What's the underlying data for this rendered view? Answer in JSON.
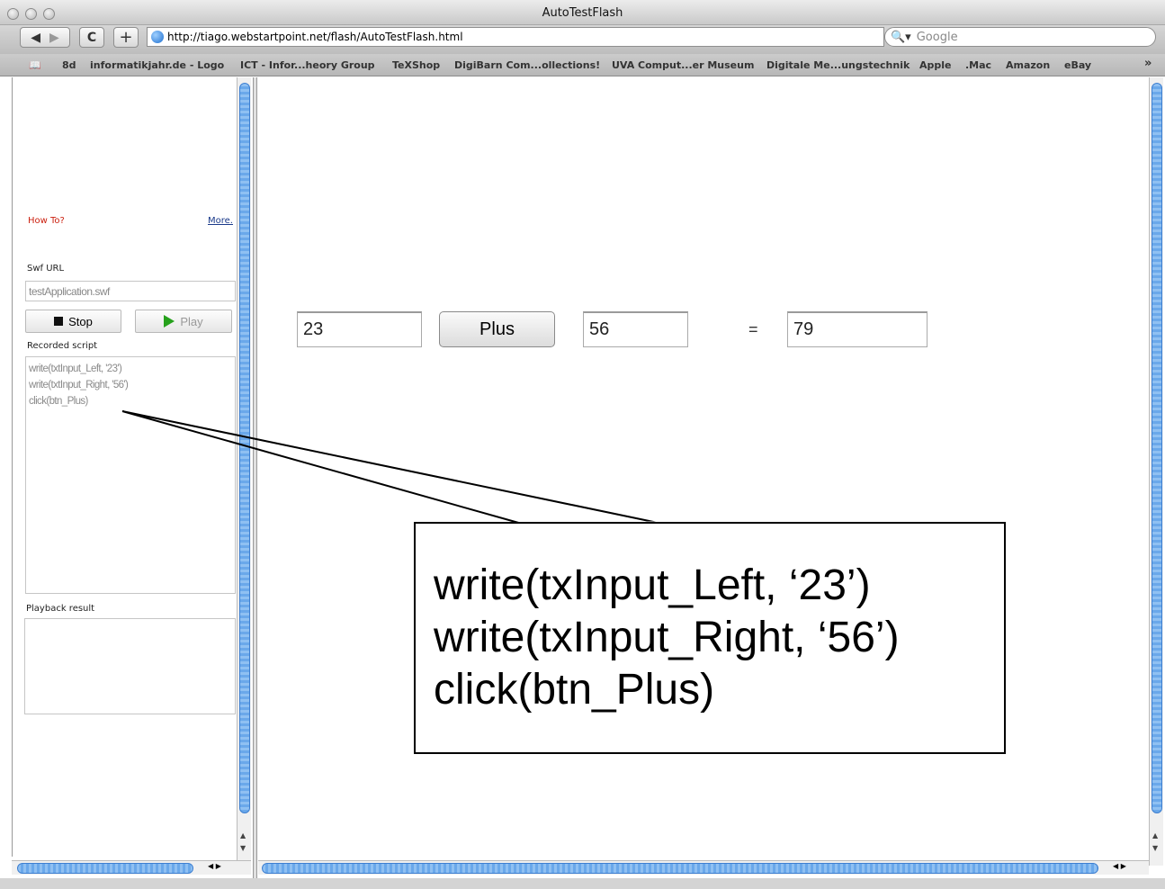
{
  "window": {
    "title": "AutoTestFlash"
  },
  "toolbar": {
    "url": "http://tiago.webstartpoint.net/flash/AutoTestFlash.html",
    "search_placeholder": "Google",
    "reload_glyph": "C",
    "add_glyph": "+"
  },
  "bookmarks": {
    "items": [
      "8d",
      "informatikjahr.de - Logo",
      "ICT - Infor...heory Group",
      "TeXShop",
      "DigiBarn Com...ollections!",
      "UVA Comput...er Museum",
      "Digitale Me...ungstechnik",
      "Apple",
      ".Mac",
      "Amazon",
      "eBay"
    ],
    "overflow": "»"
  },
  "sidebar": {
    "howto": "How To?",
    "more": "More.",
    "swf_label": "Swf URL",
    "swf_value": "testApplication.swf",
    "stop_label": "Stop",
    "play_label": "Play",
    "script_label": "Recorded script",
    "script_lines": [
      "write(txtInput_Left, '23')",
      "write(txtInput_Right, '56')",
      "click(btn_Plus)"
    ],
    "playback_label": "Playback result"
  },
  "app": {
    "left_value": "23",
    "plus_label": "Plus",
    "right_value": "56",
    "equals": "=",
    "result_value": "79"
  },
  "callout": {
    "lines": [
      "write(txInput_Left, ‘23’)",
      "write(txInput_Right, ‘56’)",
      "click(btn_Plus)"
    ]
  },
  "colors": {
    "scroll_thumb": "#6aa8ea",
    "howto": "#cc2211",
    "play": "#26a11c"
  }
}
